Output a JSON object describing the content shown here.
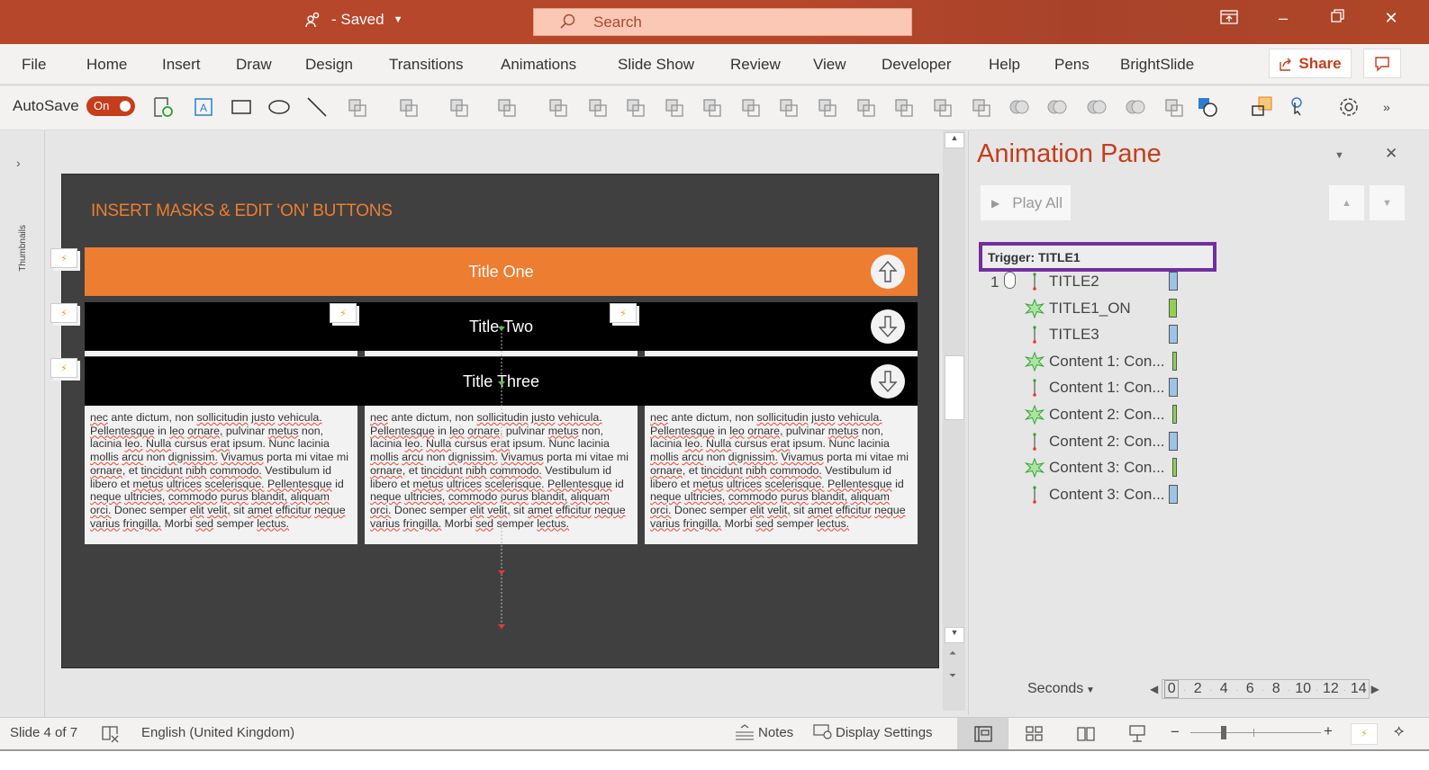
{
  "titlebar": {
    "saved_label": "- Saved",
    "search_placeholder": "Search",
    "icons": [
      "coauthor-icon",
      "ribbon-display-icon",
      "minimize-icon",
      "restore-icon",
      "close-icon"
    ]
  },
  "menu": {
    "items": [
      "File",
      "Home",
      "Insert",
      "Draw",
      "Design",
      "Transitions",
      "Animations",
      "Slide Show",
      "Review",
      "View",
      "Developer",
      "Help",
      "Pens",
      "BrightSlide"
    ],
    "share_label": "Share"
  },
  "toolbar": {
    "autosave_label": "AutoSave",
    "autosave_state": "On",
    "icons": [
      "save-sync-icon",
      "text-box-icon",
      "rectangle-icon",
      "oval-icon",
      "line-icon",
      "shape-fill-icon",
      "shape-outline-icon",
      "font-color-icon",
      "resize-icon",
      "bring-forward-icon",
      "group-icon",
      "send-backward-icon",
      "send-to-back-icon",
      "align-left-icon",
      "align-center-icon",
      "align-right-icon",
      "align-top-icon",
      "align-middle-icon",
      "align-bottom-icon",
      "distribute-horizontal-icon",
      "distribute-vertical-icon",
      "merge-union-icon",
      "merge-combine-icon",
      "merge-intersect-icon",
      "merge-subtract-icon",
      "edit-points-icon",
      "change-shape-icon",
      "selection-pane-icon",
      "action-trigger-icon",
      "settings-icon",
      "more-icon"
    ]
  },
  "thumbnails_label": "Thumbnails",
  "slide": {
    "heading": "INSERT MASKS & EDIT ‘ON’ BUTTONS",
    "titles": [
      "Title One",
      "Title Two",
      "Title Three"
    ],
    "body_text": "nec ante dictum, non sollicitudin justo vehicula. Pellentesque in leo ornare, pulvinar metus non, lacinia leo. Nulla cursus erat ipsum. Nunc lacinia mollis arcu non dignissim. Vivamus porta mi vitae mi ornare, et tincidunt nibh commodo. Vestibulum id libero et metus ultrices scelerisque. Pellentesque id neque ultricies, commodo purus blandit, aliquam orci. Donec semper elit velit, sit amet efficitur neque varius fringilla. Morbi sed semper lectus.",
    "colors": {
      "background": "#404040",
      "accent": "#ed7d31",
      "bar_dark": "#000000"
    }
  },
  "animation_pane": {
    "title": "Animation Pane",
    "play_all": "Play All",
    "trigger": "Trigger: TITLE1",
    "items": [
      {
        "num": "1",
        "mouse": true,
        "type": "motion",
        "label": "TITLE2",
        "bar": "blue"
      },
      {
        "num": "",
        "mouse": false,
        "type": "emphasis",
        "label": "TITLE1_ON",
        "bar": "green"
      },
      {
        "num": "",
        "mouse": false,
        "type": "motion",
        "label": "TITLE3",
        "bar": "blue"
      },
      {
        "num": "",
        "mouse": false,
        "type": "emphasis",
        "label": "Content 1: Con...",
        "bar": "green"
      },
      {
        "num": "",
        "mouse": false,
        "type": "motion",
        "label": "Content 1: Con...",
        "bar": "blue"
      },
      {
        "num": "",
        "mouse": false,
        "type": "emphasis",
        "label": "Content 2: Con...",
        "bar": "green"
      },
      {
        "num": "",
        "mouse": false,
        "type": "motion",
        "label": "Content 2: Con...",
        "bar": "blue"
      },
      {
        "num": "",
        "mouse": false,
        "type": "emphasis",
        "label": "Content 3: Con...",
        "bar": "green"
      },
      {
        "num": "",
        "mouse": false,
        "type": "motion",
        "label": "Content 3: Con...",
        "bar": "blue"
      }
    ],
    "seconds_label": "Seconds",
    "timeline_ticks": [
      "0",
      "2",
      "4",
      "6",
      "8",
      "10",
      "12",
      "14"
    ],
    "colors": {
      "title": "#c43e1c",
      "trigger_border": "#7030a0",
      "bar_blue": "#9dc3e6",
      "bar_green": "#92d050"
    }
  },
  "status": {
    "slide_info": "Slide 4 of 7",
    "language": "English (United Kingdom)",
    "notes": "Notes",
    "display_settings": "Display Settings",
    "zoom_level_fraction": 0.3
  }
}
